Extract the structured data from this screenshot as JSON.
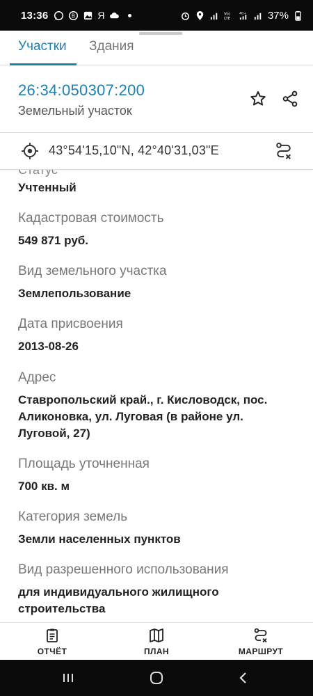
{
  "status_bar": {
    "time": "13:36",
    "carrier_glyph": "Я",
    "battery": "37%"
  },
  "tabs": [
    {
      "label": "Участки",
      "active": true
    },
    {
      "label": "Здания",
      "active": false
    }
  ],
  "object": {
    "cadastral_number": "26:34:050307:200",
    "type": "Земельный участок"
  },
  "coordinates": "43°54'15,10\"N, 42°40'31,03\"E",
  "details": {
    "cut_label": "Статус",
    "status_value": "Учтенный",
    "fields": [
      {
        "label": "Кадастровая стоимость",
        "value": "549 871 руб."
      },
      {
        "label": "Вид земельного участка",
        "value": "Землепользование"
      },
      {
        "label": "Дата присвоения",
        "value": "2013-08-26"
      },
      {
        "label": "Адрес",
        "value": "Ставропольский край., г. Кисловодск, пос. Аликоновка, ул. Луговая (в районе ул. Луговой, 27)"
      },
      {
        "label": "Площадь уточненная",
        "value": "700 кв. м"
      },
      {
        "label": "Категория земель",
        "value": "Земли населенных пунктов"
      },
      {
        "label": "Вид разрешенного использования",
        "value": "для индивидуального жилищного строительства"
      }
    ]
  },
  "bottom_nav": [
    {
      "label": "ОТЧЁТ",
      "icon": "report-icon"
    },
    {
      "label": "ПЛАН",
      "icon": "map-icon"
    },
    {
      "label": "МАРШРУТ",
      "icon": "route-icon"
    }
  ],
  "colors": {
    "accent": "#1f7fb0",
    "label": "#777777",
    "value": "#222222"
  }
}
